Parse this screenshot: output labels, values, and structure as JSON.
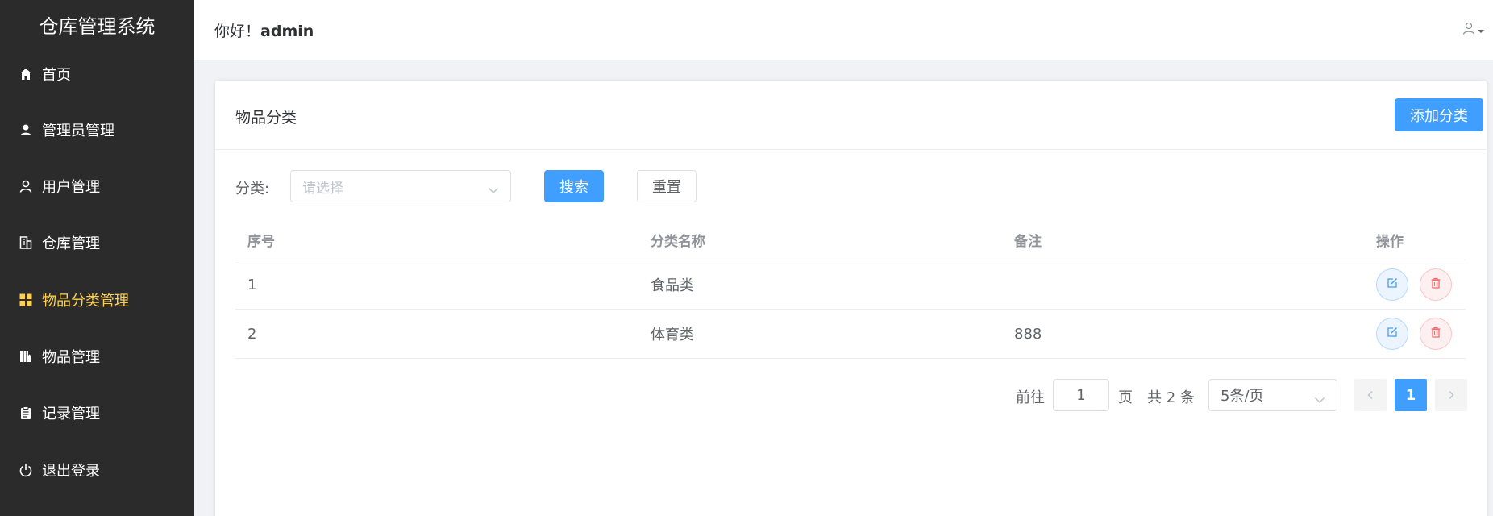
{
  "sidebar": {
    "title": "仓库管理系统",
    "items": [
      {
        "label": "首页",
        "icon": "home-icon"
      },
      {
        "label": "管理员管理",
        "icon": "admin-user-icon"
      },
      {
        "label": "用户管理",
        "icon": "user-icon"
      },
      {
        "label": "仓库管理",
        "icon": "building-icon"
      },
      {
        "label": "物品分类管理",
        "icon": "grid-icon",
        "active": true
      },
      {
        "label": "物品管理",
        "icon": "book-icon"
      },
      {
        "label": "记录管理",
        "icon": "clipboard-icon"
      },
      {
        "label": "退出登录",
        "icon": "power-icon"
      }
    ]
  },
  "header": {
    "greeting": "你好！",
    "username": "admin",
    "user_icon": "user-avatar-icon"
  },
  "card": {
    "title": "物品分类",
    "add_button": "添加分类"
  },
  "filter": {
    "label": "分类:",
    "select_placeholder": "请选择",
    "search_button": "搜索",
    "reset_button": "重置"
  },
  "table": {
    "columns": [
      "序号",
      "分类名称",
      "备注",
      "操作"
    ],
    "rows": [
      {
        "index": "1",
        "name": "食品类",
        "remark": ""
      },
      {
        "index": "2",
        "name": "体育类",
        "remark": "888"
      }
    ]
  },
  "pagination": {
    "goto_label": "前往",
    "goto_value": "1",
    "page_unit": "页",
    "total_text": "共 2 条",
    "page_size": "5条/页",
    "current_page": "1"
  },
  "colors": {
    "sidebar_bg": "#2b2b2b",
    "active": "#ffd04b",
    "primary": "#409eff",
    "danger": "#f56c6c"
  }
}
